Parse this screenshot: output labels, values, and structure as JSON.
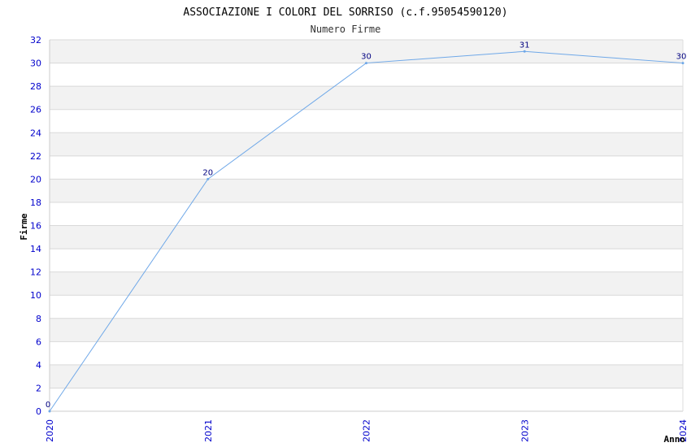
{
  "chart_data": {
    "type": "line",
    "title": "ASSOCIAZIONE I COLORI DEL SORRISO (c.f.95054590120)",
    "subtitle": "Numero Firme",
    "xlabel": "Anno",
    "ylabel": "Firme",
    "categories": [
      "2020",
      "2021",
      "2022",
      "2023",
      "2024"
    ],
    "series": [
      {
        "values": [
          0,
          20,
          30,
          31,
          30
        ]
      }
    ],
    "data_labels": [
      "0",
      "20",
      "30",
      "31",
      "30"
    ],
    "yticks": [
      "0",
      "2",
      "4",
      "6",
      "8",
      "10",
      "12",
      "14",
      "16",
      "18",
      "20",
      "22",
      "24",
      "26",
      "28",
      "30",
      "32"
    ],
    "ylim": [
      0,
      32
    ],
    "grid": true,
    "colors": {
      "line": "#6fa8e8",
      "band": "#f2f2f2",
      "grid": "#d9d9d9",
      "tick_text": "#0000cc",
      "data_label": "#000080"
    }
  }
}
